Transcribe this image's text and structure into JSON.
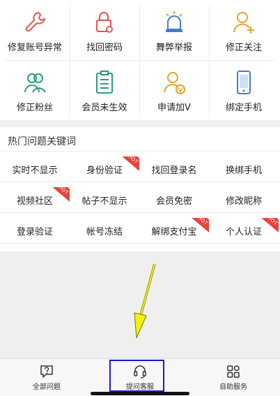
{
  "colors": {
    "accent_red": "#e0564f",
    "accent_blue": "#3f7fc8",
    "accent_gold": "#e0a32a",
    "accent_green": "#2c9a80",
    "hot_badge": "#e8433a",
    "annotation_box": "#1a1ad0",
    "annotation_arrow": "#f2f200"
  },
  "services": [
    {
      "label": "修复账号异常",
      "icon": "wrench-icon"
    },
    {
      "label": "找回密码",
      "icon": "lock-icon"
    },
    {
      "label": "舞弊举报",
      "icon": "alarm-icon"
    },
    {
      "label": "修正关注",
      "icon": "user-add-icon"
    },
    {
      "label": "修正粉丝",
      "icon": "users-icon"
    },
    {
      "label": "会员未生效",
      "icon": "clipboard-icon"
    },
    {
      "label": "申请加V",
      "icon": "user-v-icon"
    },
    {
      "label": "绑定手机",
      "icon": "phone-icon"
    }
  ],
  "hot": {
    "title": "热门问题关键词",
    "badge_text": "HOT",
    "keywords": [
      {
        "label": "实时不显示",
        "hot": false
      },
      {
        "label": "身份验证",
        "hot": true
      },
      {
        "label": "找回登录名",
        "hot": false
      },
      {
        "label": "换绑手机",
        "hot": false
      },
      {
        "label": "视频社区",
        "hot": true
      },
      {
        "label": "帖子不显示",
        "hot": false
      },
      {
        "label": "会员免密",
        "hot": false
      },
      {
        "label": "修改昵称",
        "hot": false
      },
      {
        "label": "登录验证",
        "hot": false
      },
      {
        "label": "帐号冻结",
        "hot": false
      },
      {
        "label": "解绑支付宝",
        "hot": true
      },
      {
        "label": "个人认证",
        "hot": true
      }
    ]
  },
  "tabs": [
    {
      "label": "全部问题",
      "icon": "question-bubble-icon"
    },
    {
      "label": "提问客服",
      "icon": "headset-icon"
    },
    {
      "label": "自助服务",
      "icon": "grid-icon"
    }
  ]
}
